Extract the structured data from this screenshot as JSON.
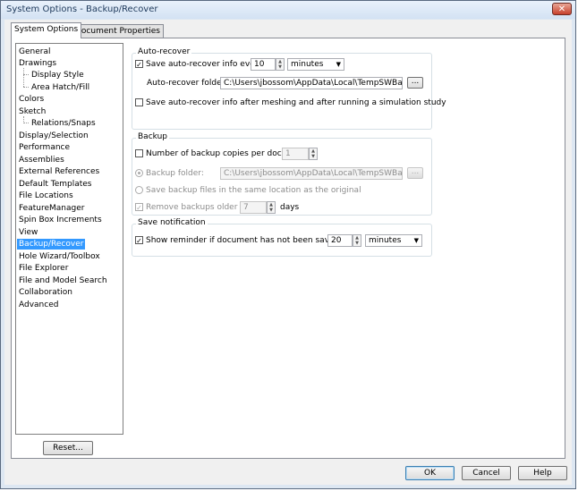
{
  "window": {
    "title": "System Options - Backup/Recover",
    "close_label": "✕"
  },
  "tabs": [
    {
      "label": "System Options",
      "active": true
    },
    {
      "label": "Document Properties",
      "active": false
    }
  ],
  "tree": {
    "items": [
      {
        "label": "General"
      },
      {
        "label": "Drawings"
      },
      {
        "label": "Display Style"
      },
      {
        "label": "Area Hatch/Fill"
      },
      {
        "label": "Colors"
      },
      {
        "label": "Sketch"
      },
      {
        "label": "Relations/Snaps"
      },
      {
        "label": "Display/Selection"
      },
      {
        "label": "Performance"
      },
      {
        "label": "Assemblies"
      },
      {
        "label": "External References"
      },
      {
        "label": "Default Templates"
      },
      {
        "label": "File Locations"
      },
      {
        "label": "FeatureManager"
      },
      {
        "label": "Spin Box Increments"
      },
      {
        "label": "View"
      },
      {
        "label": "Backup/Recover"
      },
      {
        "label": "Hole Wizard/Toolbox"
      },
      {
        "label": "File Explorer"
      },
      {
        "label": "File and Model Search"
      },
      {
        "label": "Collaboration"
      },
      {
        "label": "Advanced"
      }
    ],
    "selected": "Backup/Recover"
  },
  "reset_label": "Reset...",
  "autorecover": {
    "title": "Auto-recover",
    "save_every_label": "Save auto-recover info every:",
    "save_every_checked": true,
    "interval_value": "10",
    "interval_unit": "minutes",
    "folder_label": "Auto-recover folder:",
    "folder_value": "C:\\Users\\jbossom\\AppData\\Local\\TempSWBackupDirectory",
    "browse_label": "...",
    "after_meshing_label": "Save auto-recover info after meshing and after running a simulation study",
    "after_meshing_checked": false
  },
  "backup": {
    "title": "Backup",
    "copies_label": "Number of backup copies per document:",
    "copies_checked": false,
    "copies_value": "1",
    "folder_label": "Backup folder:",
    "folder_value": "C:\\Users\\jbossom\\AppData\\Local\\TempSWBackupDirectory",
    "browse_label": "...",
    "same_location_label": "Save backup files in the same location as the original",
    "remove_label": "Remove backups older than",
    "remove_checked": true,
    "remove_value": "7",
    "remove_unit": "days"
  },
  "notification": {
    "title": "Save notification",
    "reminder_label": "Show reminder if document has not been saved for:",
    "reminder_checked": true,
    "reminder_value": "20",
    "reminder_unit": "minutes"
  },
  "footer": {
    "ok_label": "OK",
    "cancel_label": "Cancel",
    "help_label": "Help"
  },
  "colors": {
    "selection": "#3399ff",
    "close_button": "#c7412d"
  }
}
